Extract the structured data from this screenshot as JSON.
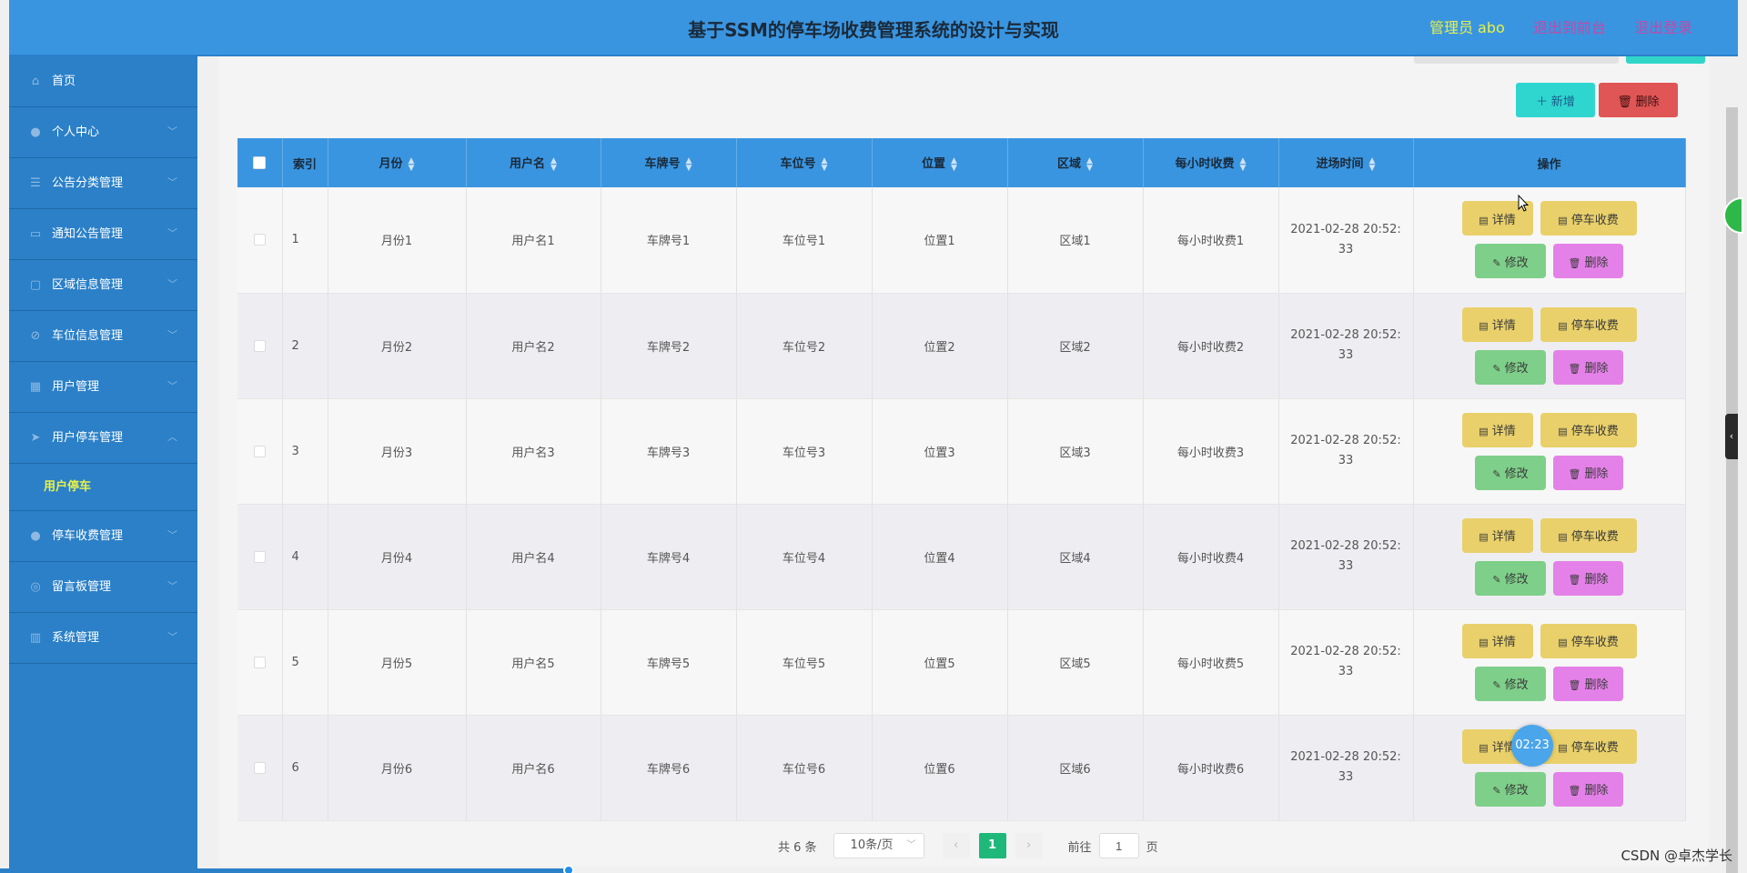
{
  "header": {
    "title": "基于SSM的停车场收费管理系统的设计与实现",
    "admin": "管理员 abo",
    "back_front": "退出到前台",
    "logout": "退出登录"
  },
  "sidebar": {
    "items": [
      {
        "label": "首页",
        "icon": "home-icon"
      },
      {
        "label": "个人中心",
        "icon": "user-icon"
      },
      {
        "label": "公告分类管理",
        "icon": "sliders-icon"
      },
      {
        "label": "通知公告管理",
        "icon": "monitor-icon"
      },
      {
        "label": "区域信息管理",
        "icon": "chat-icon"
      },
      {
        "label": "车位信息管理",
        "icon": "ban-icon"
      },
      {
        "label": "用户管理",
        "icon": "grid-icon"
      },
      {
        "label": "用户停车管理",
        "icon": "send-icon"
      },
      {
        "label": "停车收费管理",
        "icon": "user-icon"
      },
      {
        "label": "留言板管理",
        "icon": "compass-icon"
      },
      {
        "label": "系统管理",
        "icon": "chart-icon"
      }
    ],
    "sub_item": "用户停车"
  },
  "toolbar": {
    "add_label": "新增",
    "delete_label": "删除"
  },
  "table": {
    "headers": [
      "索引",
      "月份",
      "用户名",
      "车牌号",
      "车位号",
      "位置",
      "区域",
      "每小时收费",
      "进场时间",
      "操作"
    ],
    "rows": [
      {
        "index": "1",
        "month": "月份1",
        "user": "用户名1",
        "plate": "车牌号1",
        "space": "车位号1",
        "location": "位置1",
        "area": "区域1",
        "fee": "每小时收费1",
        "time_a": "2021-02-28 20:52:",
        "time_b": "33"
      },
      {
        "index": "2",
        "month": "月份2",
        "user": "用户名2",
        "plate": "车牌号2",
        "space": "车位号2",
        "location": "位置2",
        "area": "区域2",
        "fee": "每小时收费2",
        "time_a": "2021-02-28 20:52:",
        "time_b": "33"
      },
      {
        "index": "3",
        "month": "月份3",
        "user": "用户名3",
        "plate": "车牌号3",
        "space": "车位号3",
        "location": "位置3",
        "area": "区域3",
        "fee": "每小时收费3",
        "time_a": "2021-02-28 20:52:",
        "time_b": "33"
      },
      {
        "index": "4",
        "month": "月份4",
        "user": "用户名4",
        "plate": "车牌号4",
        "space": "车位号4",
        "location": "位置4",
        "area": "区域4",
        "fee": "每小时收费4",
        "time_a": "2021-02-28 20:52:",
        "time_b": "33"
      },
      {
        "index": "5",
        "month": "月份5",
        "user": "用户名5",
        "plate": "车牌号5",
        "space": "车位号5",
        "location": "位置5",
        "area": "区域5",
        "fee": "每小时收费5",
        "time_a": "2021-02-28 20:52:",
        "time_b": "33"
      },
      {
        "index": "6",
        "month": "月份6",
        "user": "用户名6",
        "plate": "车牌号6",
        "space": "车位号6",
        "location": "位置6",
        "area": "区域6",
        "fee": "每小时收费6",
        "time_a": "2021-02-28 20:52:",
        "time_b": "33"
      }
    ],
    "ops": {
      "detail": "详情",
      "park_fee": "停车收费",
      "edit": "修改",
      "remove": "删除"
    }
  },
  "pagination": {
    "total": "共 6 条",
    "page_size": "10条/页",
    "current_page": "1",
    "goto_label": "前往",
    "page_unit": "页",
    "goto_value": "1"
  },
  "overlay": {
    "timer": "02:23",
    "watermark": "CSDN @卓杰学长"
  },
  "colors": {
    "header": "#3a95e0",
    "sidebar": "#2b80c8",
    "active_sub": "#e8f04a",
    "page_active": "#1fb87a"
  }
}
